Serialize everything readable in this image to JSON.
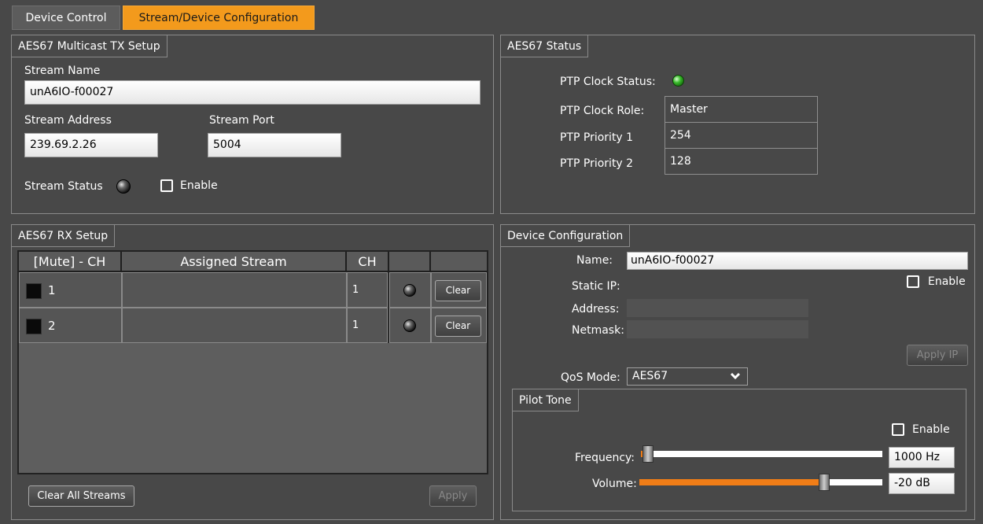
{
  "tabs": [
    {
      "label": "Device Control",
      "active": false
    },
    {
      "label": "Stream/Device Configuration",
      "active": true
    }
  ],
  "tx_setup": {
    "title": "AES67 Multicast TX Setup",
    "stream_name_label": "Stream Name",
    "stream_name_value": "unA6IO-f00027",
    "stream_address_label": "Stream Address",
    "stream_address_value": "239.69.2.26",
    "stream_port_label": "Stream Port",
    "stream_port_value": "5004",
    "stream_status_label": "Stream Status",
    "enable_label": "Enable",
    "enable_checked": false
  },
  "aes67_status": {
    "title": "AES67 Status",
    "ptp_clock_status_label": "PTP Clock Status:",
    "ptp_clock_status_color": "#38b82a",
    "ptp_clock_role_label": "PTP Clock Role:",
    "ptp_clock_role_value": "Master",
    "ptp_priority1_label": "PTP Priority 1",
    "ptp_priority1_value": "254",
    "ptp_priority2_label": "PTP Priority 2",
    "ptp_priority2_value": "128"
  },
  "rx_setup": {
    "title": "AES67 RX Setup",
    "headers": [
      "[Mute] - CH",
      "Assigned Stream",
      "CH",
      "",
      ""
    ],
    "rows": [
      {
        "ch": "1",
        "assigned_stream": "",
        "stream_ch": "1",
        "clear_label": "Clear"
      },
      {
        "ch": "2",
        "assigned_stream": "",
        "stream_ch": "1",
        "clear_label": "Clear"
      }
    ],
    "clear_all_label": "Clear All Streams",
    "apply_label": "Apply"
  },
  "device_config": {
    "title": "Device Configuration",
    "name_label": "Name:",
    "name_value": "unA6IO-f00027",
    "static_ip_label": "Static IP:",
    "enable_label": "Enable",
    "address_label": "Address:",
    "address_value": "",
    "netmask_label": "Netmask:",
    "netmask_value": "",
    "apply_ip_label": "Apply IP",
    "qos_label": "QoS Mode:",
    "qos_value": "AES67",
    "pilot_tone": {
      "title": "Pilot Tone",
      "enable_label": "Enable",
      "frequency_label": "Frequency:",
      "frequency_value": "1000 Hz",
      "frequency_level": 0.03,
      "volume_label": "Volume:",
      "volume_value": "-20 dB",
      "volume_level": 0.76
    }
  },
  "colors": {
    "accent": "#f39a1c",
    "slider_fill": "#f07d17",
    "background": "#484848"
  }
}
